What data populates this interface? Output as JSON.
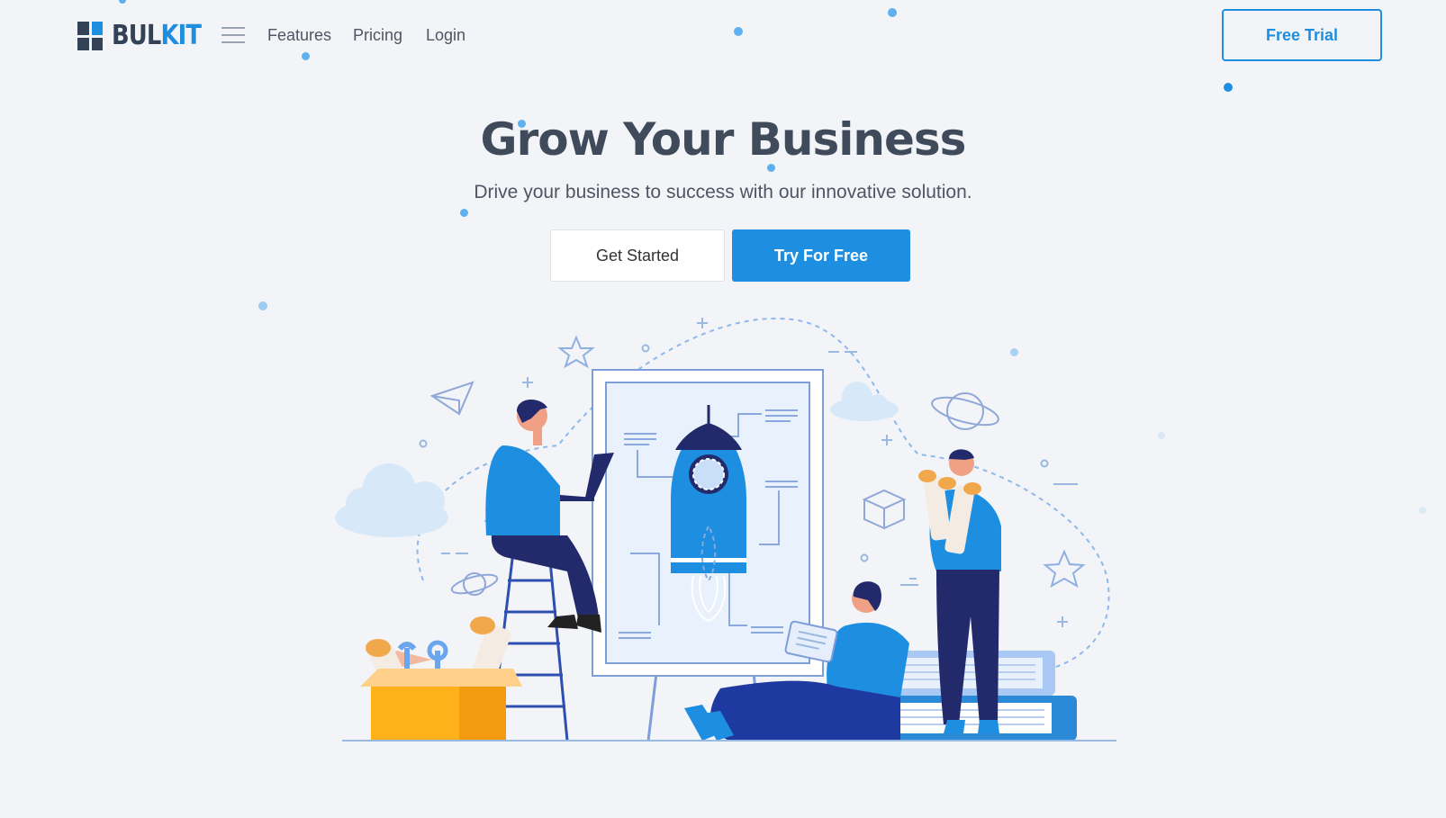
{
  "brand": {
    "name_part1": "BUL",
    "name_part2": "KIT"
  },
  "nav": {
    "menu_icon": "hamburger-icon",
    "links": [
      {
        "label": "Features"
      },
      {
        "label": "Pricing"
      },
      {
        "label": "Login"
      }
    ],
    "cta_label": "Free Trial"
  },
  "hero": {
    "title": "Grow Your Business",
    "subtitle": "Drive your business to success with our innovative solution.",
    "secondary_button": "Get Started",
    "primary_button": "Try For Free"
  },
  "colors": {
    "accent": "#1e8fe0",
    "dark": "#344258",
    "navy": "#232a6b",
    "background": "#f3f4f8"
  },
  "illustration": {
    "subject": "startup-rocket-blueprint-illustration"
  }
}
